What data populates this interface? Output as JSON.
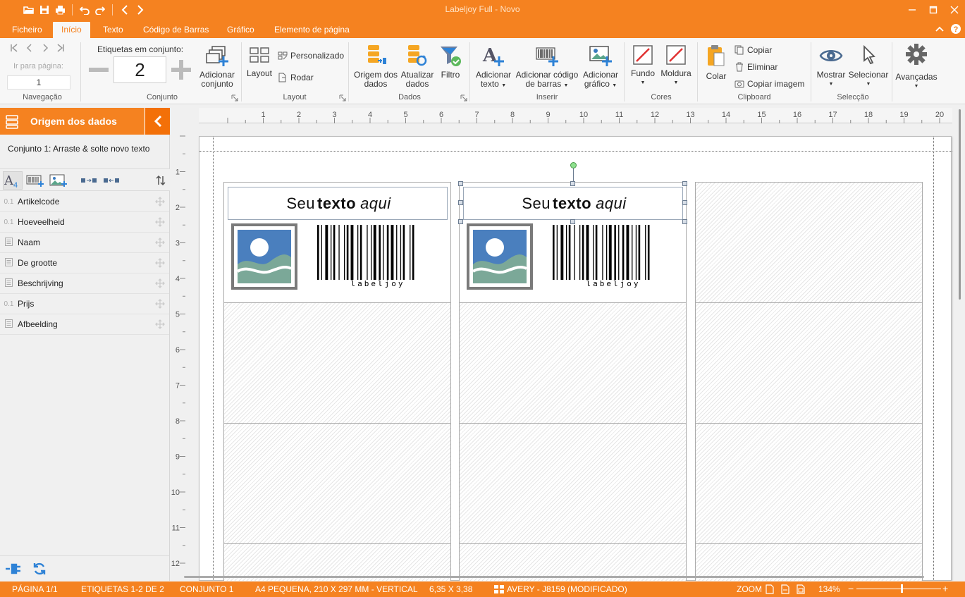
{
  "app": {
    "title": "Labeljoy Full - Novo",
    "accent": "#f58220"
  },
  "quick_access": {
    "icons": [
      "open-folder-icon",
      "save-icon",
      "print-icon",
      "undo-icon",
      "redo-icon",
      "back-icon",
      "forward-icon"
    ]
  },
  "tabs": [
    {
      "label": "Ficheiro",
      "active": false
    },
    {
      "label": "Início",
      "active": true
    },
    {
      "label": "Texto",
      "active": false
    },
    {
      "label": "Código de Barras",
      "active": false
    },
    {
      "label": "Gráfico",
      "active": false
    },
    {
      "label": "Elemento de página",
      "active": false
    }
  ],
  "ribbon": {
    "navigation": {
      "group_label": "Navegação",
      "goto_label": "Ir para página:",
      "goto_value": "1"
    },
    "set": {
      "group_label": "Conjunto",
      "labels_in_set_label": "Etiquetas em conjunto:",
      "labels_in_set_value": "2",
      "add_set_label_1": "Adicionar",
      "add_set_label_2": "conjunto"
    },
    "layout": {
      "group_label": "Layout",
      "layout_label": "Layout",
      "custom_label": "Personalizado",
      "rotate_label": "Rodar"
    },
    "data": {
      "group_label": "Dados",
      "source_label_1": "Origem dos",
      "source_label_2": "dados",
      "refresh_label_1": "Atualizar",
      "refresh_label_2": "dados",
      "filter_label": "Filtro"
    },
    "insert": {
      "group_label": "Inserir",
      "add_text_1": "Adicionar",
      "add_text_2": "texto",
      "add_barcode_1": "Adicionar código",
      "add_barcode_2": "de barras",
      "add_graphic_1": "Adicionar",
      "add_graphic_2": "gráfico"
    },
    "colors": {
      "group_label": "Cores",
      "background_label": "Fundo",
      "frame_label": "Moldura"
    },
    "clipboard": {
      "group_label": "Clipboard",
      "paste_label": "Colar",
      "copy_label": "Copiar",
      "delete_label": "Eliminar",
      "copy_image_label": "Copiar imagem"
    },
    "selection": {
      "group_label": "Selecção",
      "show_label": "Mostrar",
      "select_label": "Selecionar"
    },
    "advanced": {
      "label": "Avançadas"
    }
  },
  "panel": {
    "title": "Origem dos dados",
    "set_description": "Conjunto 1: Arraste & solte novo texto",
    "fields": [
      {
        "type": "0.1",
        "name": "Artikelcode"
      },
      {
        "type": "0.1",
        "name": "Hoeveelheid"
      },
      {
        "type": "",
        "name": "Naam"
      },
      {
        "type": "",
        "name": "De grootte"
      },
      {
        "type": "",
        "name": "Beschrijving"
      },
      {
        "type": "0.1",
        "name": "Prijs"
      },
      {
        "type": "",
        "name": "Afbeelding"
      }
    ]
  },
  "ruler": {
    "h_labels": [
      "1",
      "2",
      "3",
      "4",
      "5",
      "6",
      "7",
      "8",
      "9",
      "10",
      "11",
      "12",
      "13",
      "14",
      "15",
      "16",
      "17",
      "18",
      "19",
      "20"
    ],
    "v_labels": [
      "1",
      "2",
      "3",
      "4",
      "5",
      "6",
      "7",
      "8",
      "9",
      "10",
      "11",
      "12"
    ]
  },
  "labels": {
    "text_parts": {
      "a": "Seu",
      "b": "texto",
      "c": "aqui"
    },
    "barcode_caption": "labeljoy"
  },
  "status": {
    "page": "PÁGINA 1/1",
    "labels": "ETIQUETAS 1-2 DE 2",
    "set": "CONJUNTO 1",
    "paper": "A4 PEQUENA, 210 X 297 MM - VERTICAL",
    "size": "6,35 X 3,38",
    "template": "AVERY - J8159 (MODIFICADO)",
    "zoom_label": "ZOOM",
    "zoom_value": "134%",
    "zoom_minus": "−",
    "zoom_plus": "+"
  }
}
